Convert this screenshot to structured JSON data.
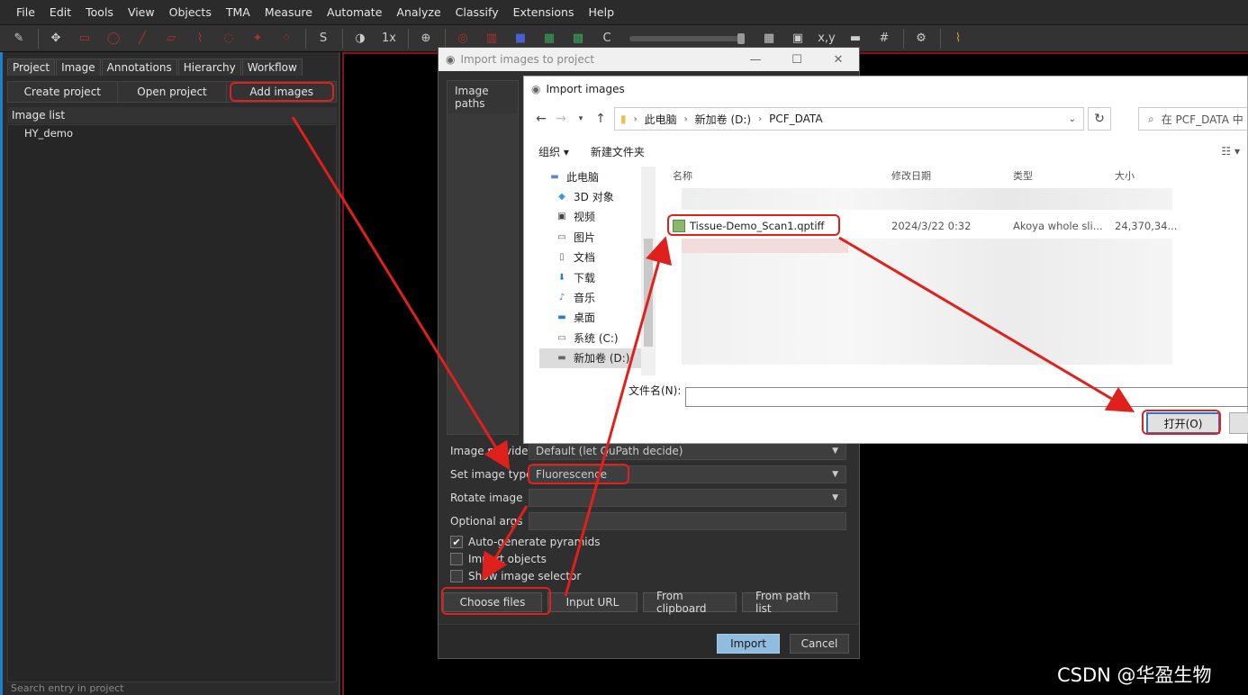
{
  "menu": [
    "File",
    "Edit",
    "Tools",
    "View",
    "Objects",
    "TMA",
    "Measure",
    "Automate",
    "Analyze",
    "Classify",
    "Extensions",
    "Help"
  ],
  "toolbar": {
    "zoom": "1x",
    "s_label": "S",
    "c_label": "C",
    "xy_label": "x,y"
  },
  "left_panel": {
    "tabs": [
      "Project",
      "Image",
      "Annotations",
      "Hierarchy",
      "Workflow"
    ],
    "buttons": {
      "create": "Create project",
      "open": "Open project",
      "add": "Add images"
    },
    "list_header": "Image list",
    "items": [
      "HY_demo"
    ],
    "search_placeholder": "Search entry in project"
  },
  "import_dialog": {
    "title": "Import images to project",
    "image_paths_label": "Image paths",
    "image_provider_label": "Image provider",
    "image_provider_value": "Default (let QuPath decide)",
    "image_type_label": "Set image type",
    "image_type_value": "Fluorescence",
    "rotate_label": "Rotate image",
    "rotate_value": "",
    "optional_args_label": "Optional args",
    "opt_pyramids": "Auto-generate pyramids",
    "opt_objects": "Import objects",
    "opt_selector": "Show image selector",
    "btn_choose": "Choose files",
    "btn_url": "Input URL",
    "btn_clipboard": "From clipboard",
    "btn_pathlist": "From path list",
    "btn_import": "Import",
    "btn_cancel": "Cancel"
  },
  "file_dialog": {
    "title": "Import images",
    "path": [
      "此电脑",
      "新加卷 (D:)",
      "PCF_DATA"
    ],
    "search": "在 PCF_DATA 中",
    "organize": "组织 ▾",
    "new_folder": "新建文件夹",
    "tree": [
      "此电脑",
      "3D 对象",
      "视频",
      "图片",
      "文档",
      "下载",
      "音乐",
      "桌面",
      "系统 (C:)",
      "新加卷 (D:)"
    ],
    "columns": [
      "名称",
      "修改日期",
      "类型",
      "大小"
    ],
    "file": {
      "name": "Tissue-Demo_Scan1.qptiff",
      "date": "2024/3/22 0:32",
      "type": "Akoya whole sli...",
      "size": "24,370,34..."
    },
    "filename_label": "文件名(N):",
    "open_button": "打开(O)"
  },
  "watermark": "CSDN @华盈生物"
}
